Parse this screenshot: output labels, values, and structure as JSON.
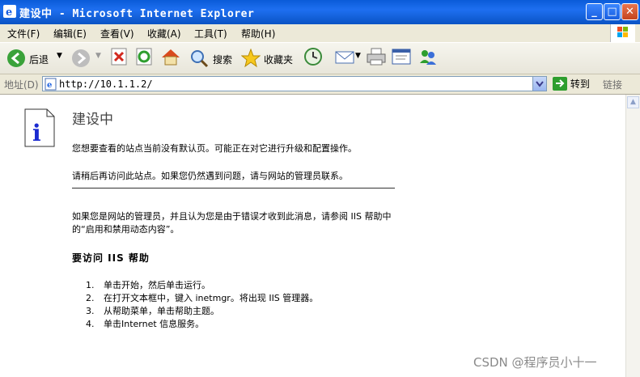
{
  "window": {
    "title": "建设中 - Microsoft Internet Explorer",
    "min": "_",
    "max": "□",
    "close": "✕"
  },
  "menu": [
    "文件(F)",
    "编辑(E)",
    "查看(V)",
    "收藏(A)",
    "工具(T)",
    "帮助(H)"
  ],
  "toolbar": {
    "back": "后退",
    "search": "搜索",
    "favorites": "收藏夹"
  },
  "address": {
    "label": "地址(D)",
    "url": "http://10.1.1.2/",
    "go": "转到",
    "links": "链接"
  },
  "page": {
    "heading": "建设中",
    "p1": "您想要查看的站点当前没有默认页。可能正在对它进行升级和配置操作。",
    "p2": "请稍后再访问此站点。如果您仍然遇到问题，请与网站的管理员联系。",
    "p3": "如果您是网站的管理员，并且认为您是由于错误才收到此消息，请参阅 IIS 帮助中的“启用和禁用动态内容”。",
    "help_heading": "要访问 IIS 帮助",
    "steps": [
      "单击开始，然后单击运行。",
      "在打开文本框中，键入 inetmgr。将出现 IIS 管理器。",
      "从帮助菜单，单击帮助主题。",
      "单击Internet 信息服务。"
    ]
  },
  "watermark": "CSDN @程序员小十一"
}
